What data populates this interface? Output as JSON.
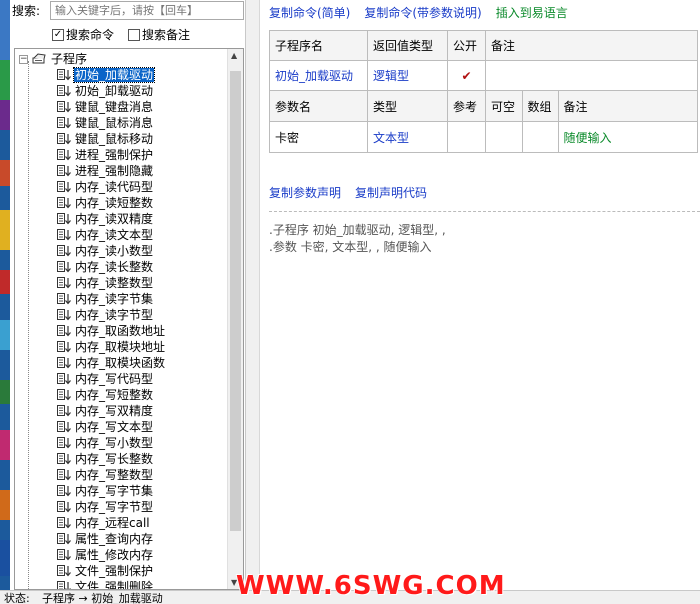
{
  "search": {
    "label": "搜索:",
    "placeholder": "输入关键字后，请按【回车】"
  },
  "filters": [
    {
      "label": "搜索命令",
      "checked": true
    },
    {
      "label": "搜索备注",
      "checked": false
    }
  ],
  "tree": {
    "root_label": "子程序",
    "items": [
      "初始_加载驱动",
      "初始_卸载驱动",
      "键鼠_键盘消息",
      "键鼠_鼠标消息",
      "键鼠_鼠标移动",
      "进程_强制保护",
      "进程_强制隐藏",
      "内存_读代码型",
      "内存_读短整数",
      "内存_读双精度",
      "内存_读文本型",
      "内存_读小数型",
      "内存_读长整数",
      "内存_读整数型",
      "内存_读字节集",
      "内存_读字节型",
      "内存_取函数地址",
      "内存_取模块地址",
      "内存_取模块函数",
      "内存_写代码型",
      "内存_写短整数",
      "内存_写双精度",
      "内存_写文本型",
      "内存_写小数型",
      "内存_写长整数",
      "内存_写整数型",
      "内存_写字节集",
      "内存_写字节型",
      "内存_远程call",
      "属性_查询内存",
      "属性_修改内存",
      "文件_强制保护",
      "文件_强制删除"
    ],
    "selected_index": 0
  },
  "toolbar": {
    "copy_simple": "复制命令(简单)",
    "copy_with_params": "复制命令(带参数说明)",
    "insert": "插入到易语言"
  },
  "sub_table": {
    "headers": [
      "子程序名",
      "返回值类型",
      "公开",
      "备注"
    ],
    "row": {
      "name": "初始_加载驱动",
      "return_type": "逻辑型",
      "public": "✔",
      "note": ""
    }
  },
  "param_table": {
    "headers": [
      "参数名",
      "类型",
      "参考",
      "可空",
      "数组",
      "备注"
    ],
    "rows": [
      {
        "name": "卡密",
        "type": "文本型",
        "ref": "",
        "nullable": "",
        "array": "",
        "note": "随便输入"
      }
    ]
  },
  "links2": {
    "copy_param_decl": "复制参数声明",
    "copy_decl_code": "复制声明代码"
  },
  "code": {
    "line1": ".子程序 初始_加载驱动, 逻辑型, ,",
    "line2": ".参数 卡密, 文本型, , 随便输入"
  },
  "status": {
    "label": "状态:",
    "text": "子程序 → 初始_加载驱动"
  },
  "watermark": "WWW.6SWG.COM",
  "colors": {
    "selection": "#0a64c8",
    "link": "#1a3cc8",
    "green_link": "#0a8a2a",
    "watermark": "#ff1a1a"
  }
}
